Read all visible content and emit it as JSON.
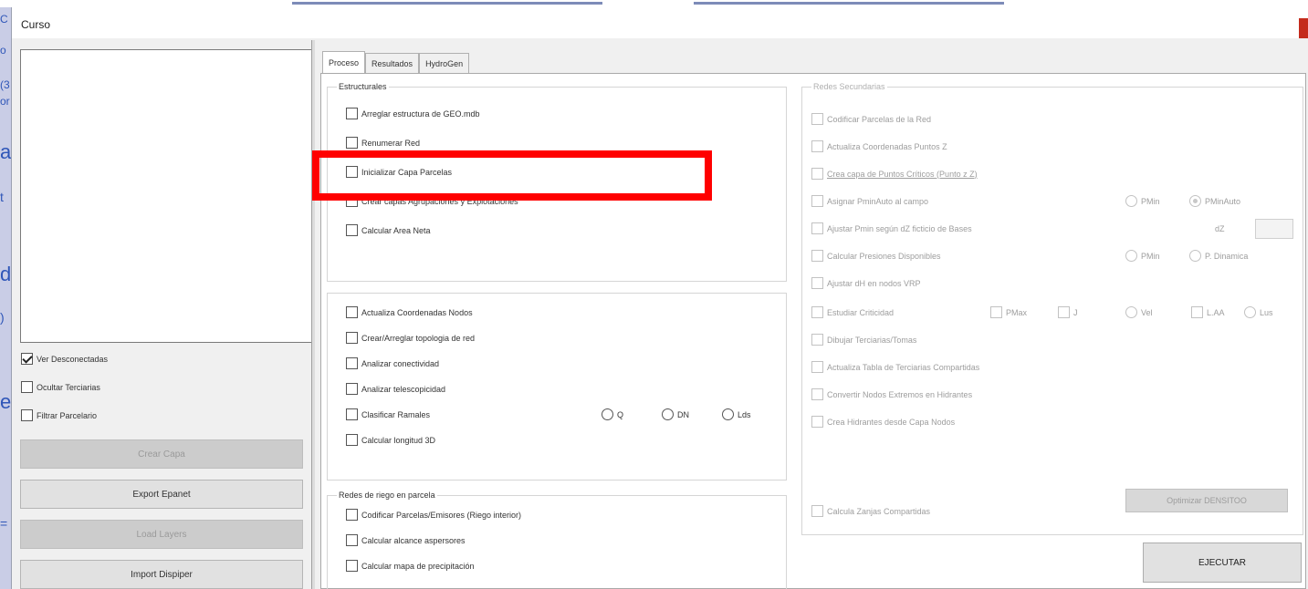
{
  "background": {
    "fragments": [
      "C",
      "o",
      "(3",
      "or",
      "a",
      "t",
      "d",
      ")",
      "e",
      "="
    ]
  },
  "window": {
    "title": "Curso"
  },
  "left_panel": {
    "checkboxes": [
      {
        "label": "Ver Desconectadas",
        "checked": true
      },
      {
        "label": "Ocultar Terciarias",
        "checked": false
      },
      {
        "label": "Filtrar Parcelario",
        "checked": false
      }
    ],
    "buttons": [
      {
        "label": "Crear Capa",
        "enabled": false
      },
      {
        "label": "Export Epanet",
        "enabled": true
      },
      {
        "label": "Load Layers",
        "enabled": false
      },
      {
        "label": "Import Dispiper",
        "enabled": true
      }
    ]
  },
  "tabs": [
    "Proceso",
    "Resultados",
    "HydroGen"
  ],
  "active_tab": "Proceso",
  "estructurales": {
    "title": "Estructurales",
    "items": [
      "Arreglar estructura de GEO.mdb",
      "Renumerar Red",
      "Inicializar Capa Parcelas",
      "Crear capas Agrupaciones y Explotaciones",
      "Calcular Area Neta"
    ]
  },
  "topologia": {
    "items": [
      "Actualiza Coordenadas Nodos",
      "Crear/Arreglar topologia de red",
      "Analizar conectividad",
      "Analizar telescopicidad",
      "Clasificar Ramales",
      "Calcular longitud 3D"
    ],
    "radios": [
      "Q",
      "DN",
      "Lds"
    ]
  },
  "riego": {
    "title": "Redes de riego en parcela",
    "items": [
      "Codificar Parcelas/Emisores (Riego interior)",
      "Calcular alcance aspersores",
      "Calcular mapa de precipitación"
    ]
  },
  "secundarias": {
    "title": "Redes Secundarias",
    "items": [
      "Codificar Parcelas de la Red",
      "Actualiza Coordenadas Puntos Z",
      "Crea capa de Puntos Críticos (Punto z Z)",
      "Asignar PminAuto al campo",
      "Ajustar Pmin según dZ ficticio de Bases",
      "Calcular Presiones Disponibles",
      "Ajustar dH en nodos VRP",
      "Estudiar Criticidad",
      "Dibujar Terciarias/Tomas",
      "Actualiza Tabla de Terciarias Compartidas",
      "Convertir Nodos Extremos en Hidrantes",
      "Crea Hidrantes desde Capa Nodos"
    ],
    "pmin_radios": [
      "PMin",
      "PMinAuto"
    ],
    "dz_label": "dZ",
    "pres_radios": [
      "PMin",
      "P. Dinamica"
    ],
    "crit_options": [
      "PMax",
      "J",
      "Vel",
      "L.AA",
      "Lus"
    ],
    "zanjas_label": "Calcula Zanjas Compartidas",
    "optimize_label": "Optimizar DENSITOO"
  },
  "execute_label": "EJECUTAR",
  "colors": {
    "highlight": "#ff0000",
    "close": "#c42b1c",
    "bg_text": "#2f56b8"
  }
}
